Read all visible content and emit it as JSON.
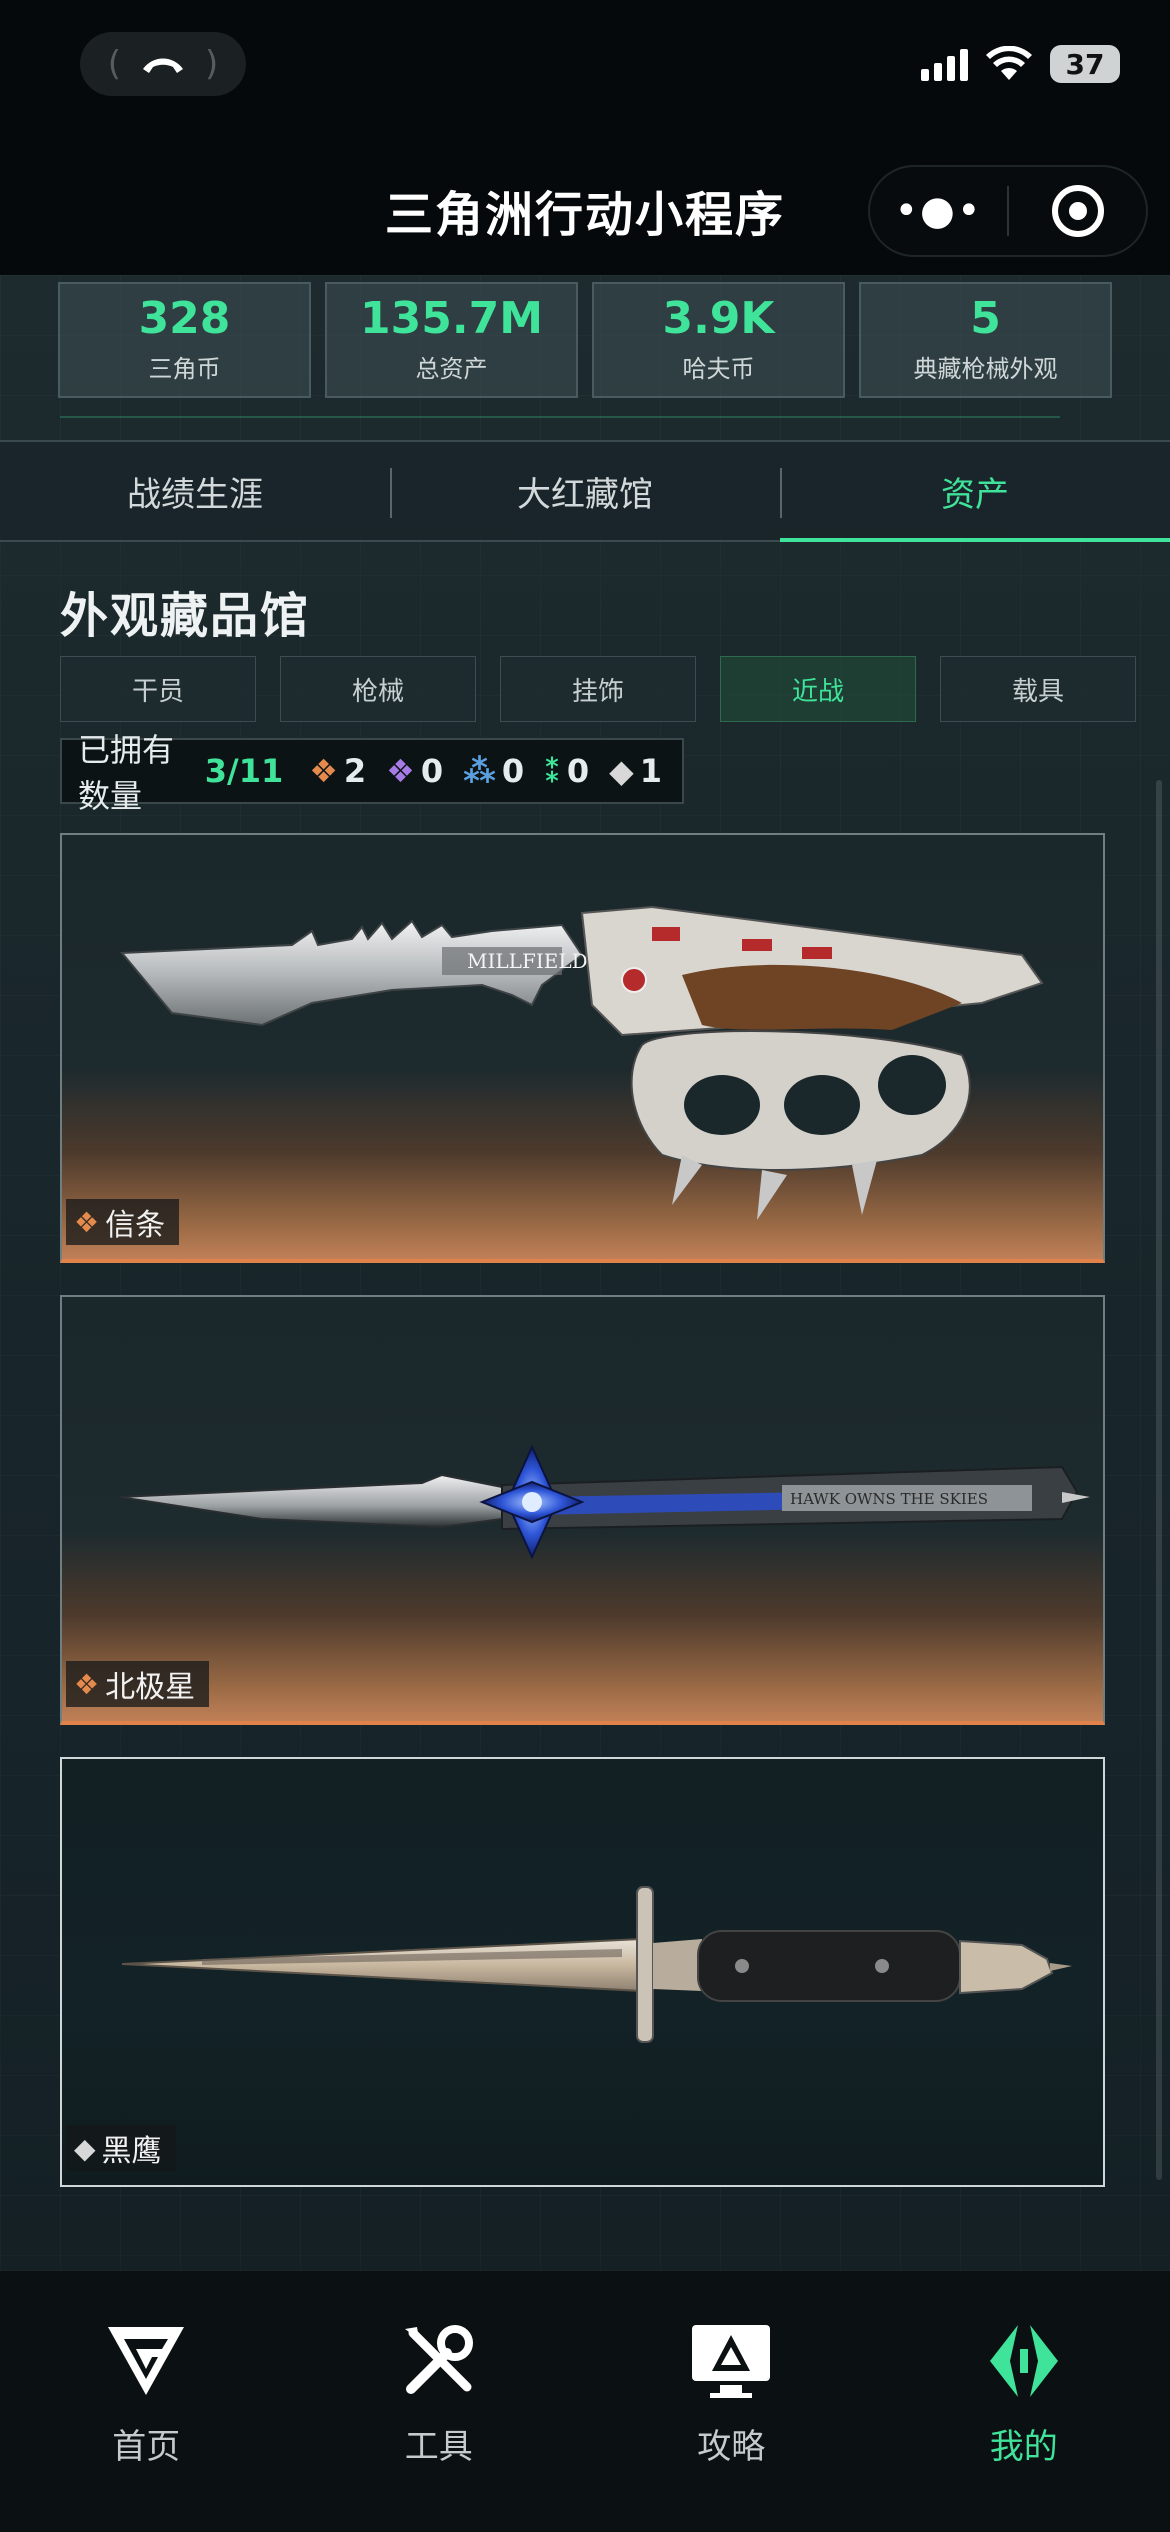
{
  "status_bar": {
    "battery": "37"
  },
  "header": {
    "title": "三角洲行动小程序",
    "menu_icon": "more-dots-icon",
    "close_icon": "target-icon"
  },
  "stats": [
    {
      "value": "328",
      "label": "三角币"
    },
    {
      "value": "135.7M",
      "label": "总资产"
    },
    {
      "value": "3.9K",
      "label": "哈夫币"
    },
    {
      "value": "5",
      "label": "典藏枪械外观"
    }
  ],
  "main_tabs": [
    {
      "label": "战绩生涯",
      "active": false
    },
    {
      "label": "大红藏馆",
      "active": false
    },
    {
      "label": "资产",
      "active": true
    }
  ],
  "section": {
    "title": "外观藏品馆",
    "sub_tabs": [
      {
        "label": "干员",
        "active": false
      },
      {
        "label": "枪械",
        "active": false
      },
      {
        "label": "挂饰",
        "active": false
      },
      {
        "label": "近战",
        "active": true
      },
      {
        "label": "载具",
        "active": false
      }
    ],
    "owned_label": "已拥有数量",
    "owned_count": "3/11",
    "rarity_counts": [
      {
        "color": "#e48a4d",
        "count": "2"
      },
      {
        "color": "#a57be6",
        "count": "0"
      },
      {
        "color": "#5aa0e0",
        "count": "0"
      },
      {
        "color": "#3fe39a",
        "count": "0"
      },
      {
        "color": "#d8d8d8",
        "count": "1"
      }
    ]
  },
  "items": [
    {
      "name": "信条",
      "rarity_color": "#e48a4d",
      "engraving": "MILLFIELD"
    },
    {
      "name": "北极星",
      "rarity_color": "#e48a4d",
      "engraving": "HAWK OWNS THE SKIES"
    },
    {
      "name": "黑鹰",
      "rarity_color": "#d8d8d8",
      "engraving": ""
    }
  ],
  "bottom_nav": [
    {
      "label": "首页",
      "icon": "home-logo-icon",
      "active": false
    },
    {
      "label": "工具",
      "icon": "tools-icon",
      "active": false
    },
    {
      "label": "攻略",
      "icon": "guide-monitor-icon",
      "active": false
    },
    {
      "label": "我的",
      "icon": "profile-logo-icon",
      "active": true
    }
  ]
}
